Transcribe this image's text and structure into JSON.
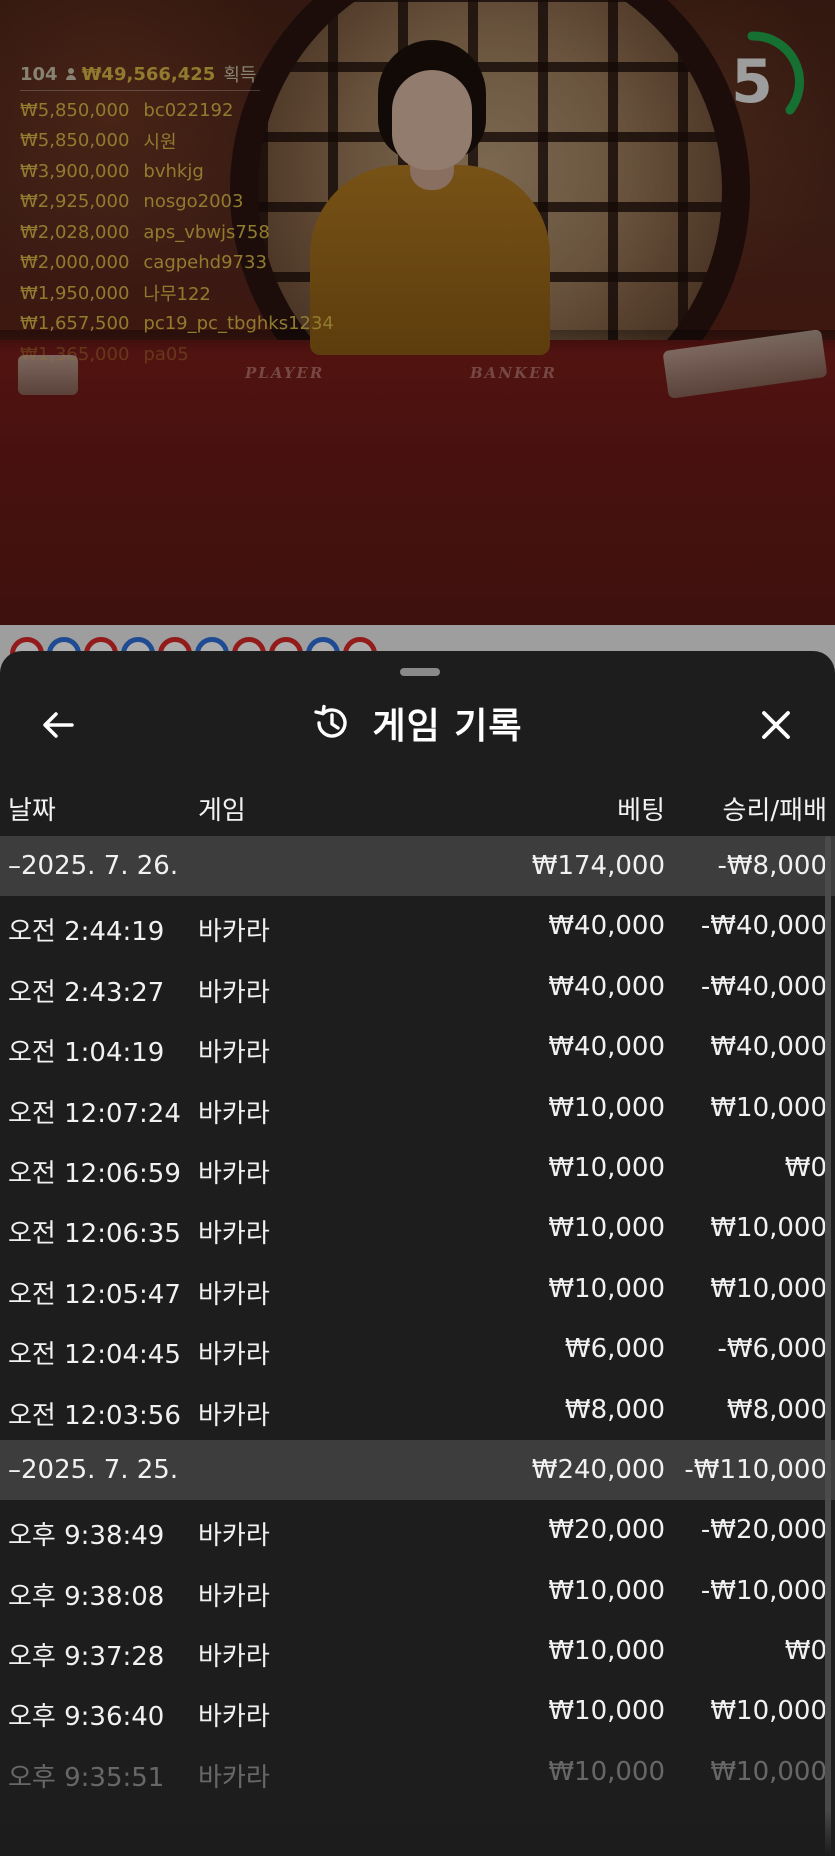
{
  "stream": {
    "timer_value": "5",
    "winners_count": "104",
    "winners_total": "₩49,566,425",
    "winners_suffix": "획득",
    "winners": [
      {
        "amount": "₩5,850,000",
        "name": "bc022192"
      },
      {
        "amount": "₩5,850,000",
        "name": "시원"
      },
      {
        "amount": "₩3,900,000",
        "name": "bvhkjg"
      },
      {
        "amount": "₩2,925,000",
        "name": "nosgo2003"
      },
      {
        "amount": "₩2,028,000",
        "name": "aps_vbwjs758"
      },
      {
        "amount": "₩2,000,000",
        "name": "cagpehd9733"
      },
      {
        "amount": "₩1,950,000",
        "name": "나무122"
      },
      {
        "amount": "₩1,657,500",
        "name": "pc19_pc_tbghks1234"
      },
      {
        "amount": "₩1,365,000",
        "name": "pa05"
      }
    ],
    "table_labels": {
      "player": "PLAYER",
      "banker": "BANKER"
    },
    "colors": {
      "gold": "#d6b546",
      "timer_ring": "#1fa64a",
      "player_blue": "#2f6fd8",
      "banker_red": "#d82a2a"
    }
  },
  "sheet": {
    "title": "게임 기록",
    "back_icon": "arrow-left-icon",
    "close_icon": "close-icon",
    "history_icon": "history-clock-icon",
    "columns": {
      "date": "날짜",
      "game": "게임",
      "bet": "베팅",
      "result": "승리/패배"
    },
    "groups": [
      {
        "date": "–2025. 7. 26.",
        "bet_total": "₩174,000",
        "result_total": "-₩8,000",
        "rows": [
          {
            "time": "오전 2:44:19",
            "game": "바카라",
            "bet": "₩40,000",
            "result": "-₩40,000"
          },
          {
            "time": "오전 2:43:27",
            "game": "바카라",
            "bet": "₩40,000",
            "result": "-₩40,000"
          },
          {
            "time": "오전 1:04:19",
            "game": "바카라",
            "bet": "₩40,000",
            "result": "₩40,000"
          },
          {
            "time": "오전 12:07:24",
            "game": "바카라",
            "bet": "₩10,000",
            "result": "₩10,000"
          },
          {
            "time": "오전 12:06:59",
            "game": "바카라",
            "bet": "₩10,000",
            "result": "₩0"
          },
          {
            "time": "오전 12:06:35",
            "game": "바카라",
            "bet": "₩10,000",
            "result": "₩10,000"
          },
          {
            "time": "오전 12:05:47",
            "game": "바카라",
            "bet": "₩10,000",
            "result": "₩10,000"
          },
          {
            "time": "오전 12:04:45",
            "game": "바카라",
            "bet": "₩6,000",
            "result": "-₩6,000"
          },
          {
            "time": "오전 12:03:56",
            "game": "바카라",
            "bet": "₩8,000",
            "result": "₩8,000"
          }
        ]
      },
      {
        "date": "–2025. 7. 25.",
        "bet_total": "₩240,000",
        "result_total": "-₩110,000",
        "rows": [
          {
            "time": "오후 9:38:49",
            "game": "바카라",
            "bet": "₩20,000",
            "result": "-₩20,000"
          },
          {
            "time": "오후 9:38:08",
            "game": "바카라",
            "bet": "₩10,000",
            "result": "-₩10,000"
          },
          {
            "time": "오후 9:37:28",
            "game": "바카라",
            "bet": "₩10,000",
            "result": "₩0"
          },
          {
            "time": "오후 9:36:40",
            "game": "바카라",
            "bet": "₩10,000",
            "result": "₩10,000"
          },
          {
            "time": "오후 9:35:51",
            "game": "바카라",
            "bet": "₩10,000",
            "result": "₩10,000"
          }
        ]
      }
    ]
  }
}
